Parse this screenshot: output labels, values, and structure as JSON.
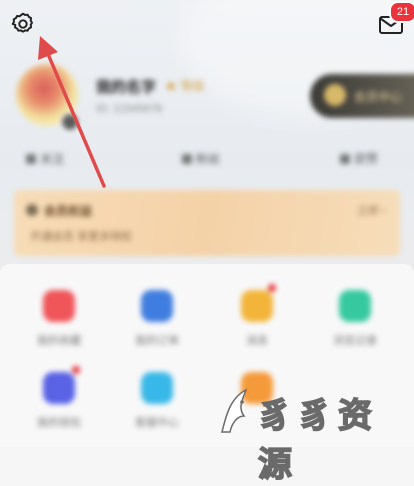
{
  "header": {
    "settings_icon": "gear-icon",
    "messages_icon": "mail-icon",
    "messages_badge": "21"
  },
  "profile": {
    "avatar_text": "",
    "username": "我的名字",
    "level": "★ 等级",
    "user_id": "ID: 12345678",
    "vip_label": "会员中心"
  },
  "stats": [
    {
      "label": "关注"
    },
    {
      "label": "粉丝"
    },
    {
      "label": "获赞"
    }
  ],
  "banner": {
    "title": "会员权益",
    "more": "立即 ›",
    "desc": "开通会员 享更多特权"
  },
  "grid": [
    {
      "label": "我的收藏",
      "color": "#f0555a"
    },
    {
      "label": "我的订单",
      "color": "#3f7de0"
    },
    {
      "label": "消息",
      "color": "#f2b53a"
    },
    {
      "label": "浏览记录",
      "color": "#36c9a0"
    },
    {
      "label": "我的钱包",
      "color": "#5a62e6"
    },
    {
      "label": "客服中心",
      "color": "#38b8e8"
    },
    {
      "label": "",
      "color": "#f59a3a"
    }
  ],
  "watermark": {
    "text": "豸豸资源"
  },
  "colors": {
    "arrow": "#e04a4a",
    "badge": "#e8343a"
  }
}
